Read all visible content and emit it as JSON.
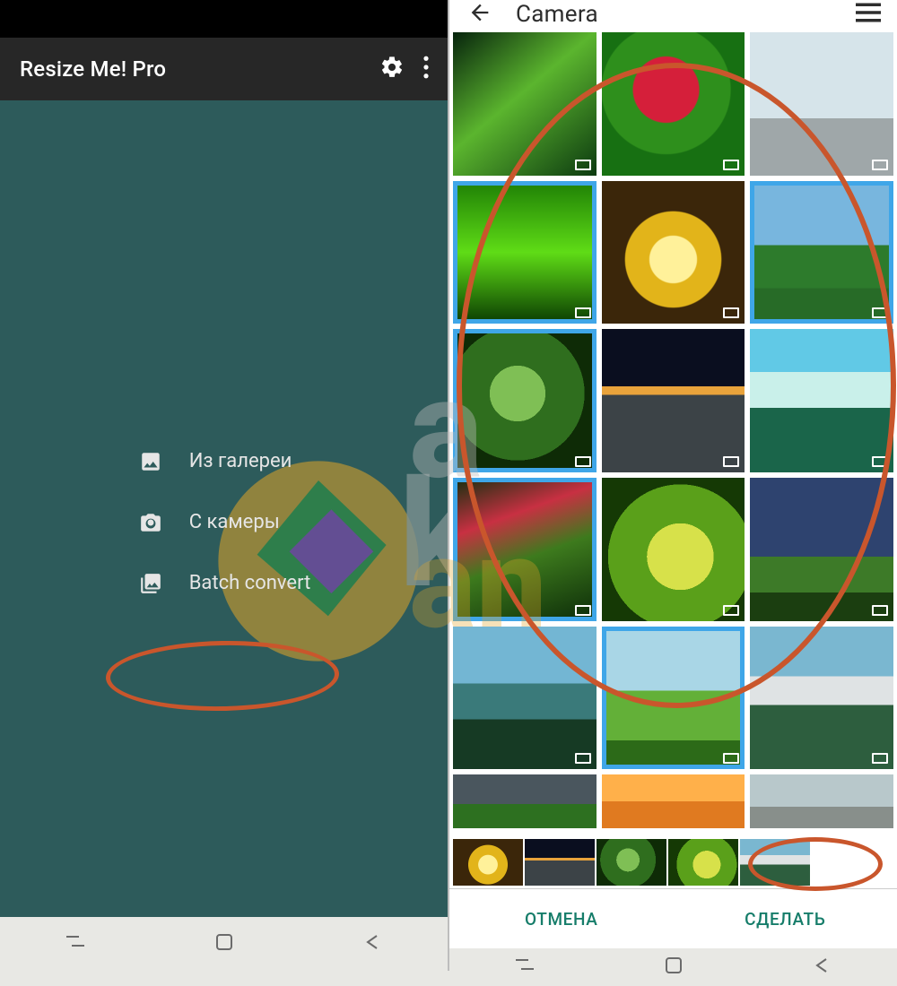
{
  "left": {
    "app_title": "Resize Me! Pro",
    "menu": {
      "from_gallery": "Из галереи",
      "from_camera": "С камеры",
      "batch_convert": "Batch convert"
    }
  },
  "right": {
    "title": "Camera",
    "buttons": {
      "cancel": "ОТМЕНА",
      "done": "СДЕЛАТЬ"
    },
    "grid_selected_indices": [
      4,
      6,
      7,
      10,
      14
    ],
    "selected_strip_classes": [
      "t5",
      "t8",
      "t7",
      "t11",
      "t15"
    ]
  }
}
